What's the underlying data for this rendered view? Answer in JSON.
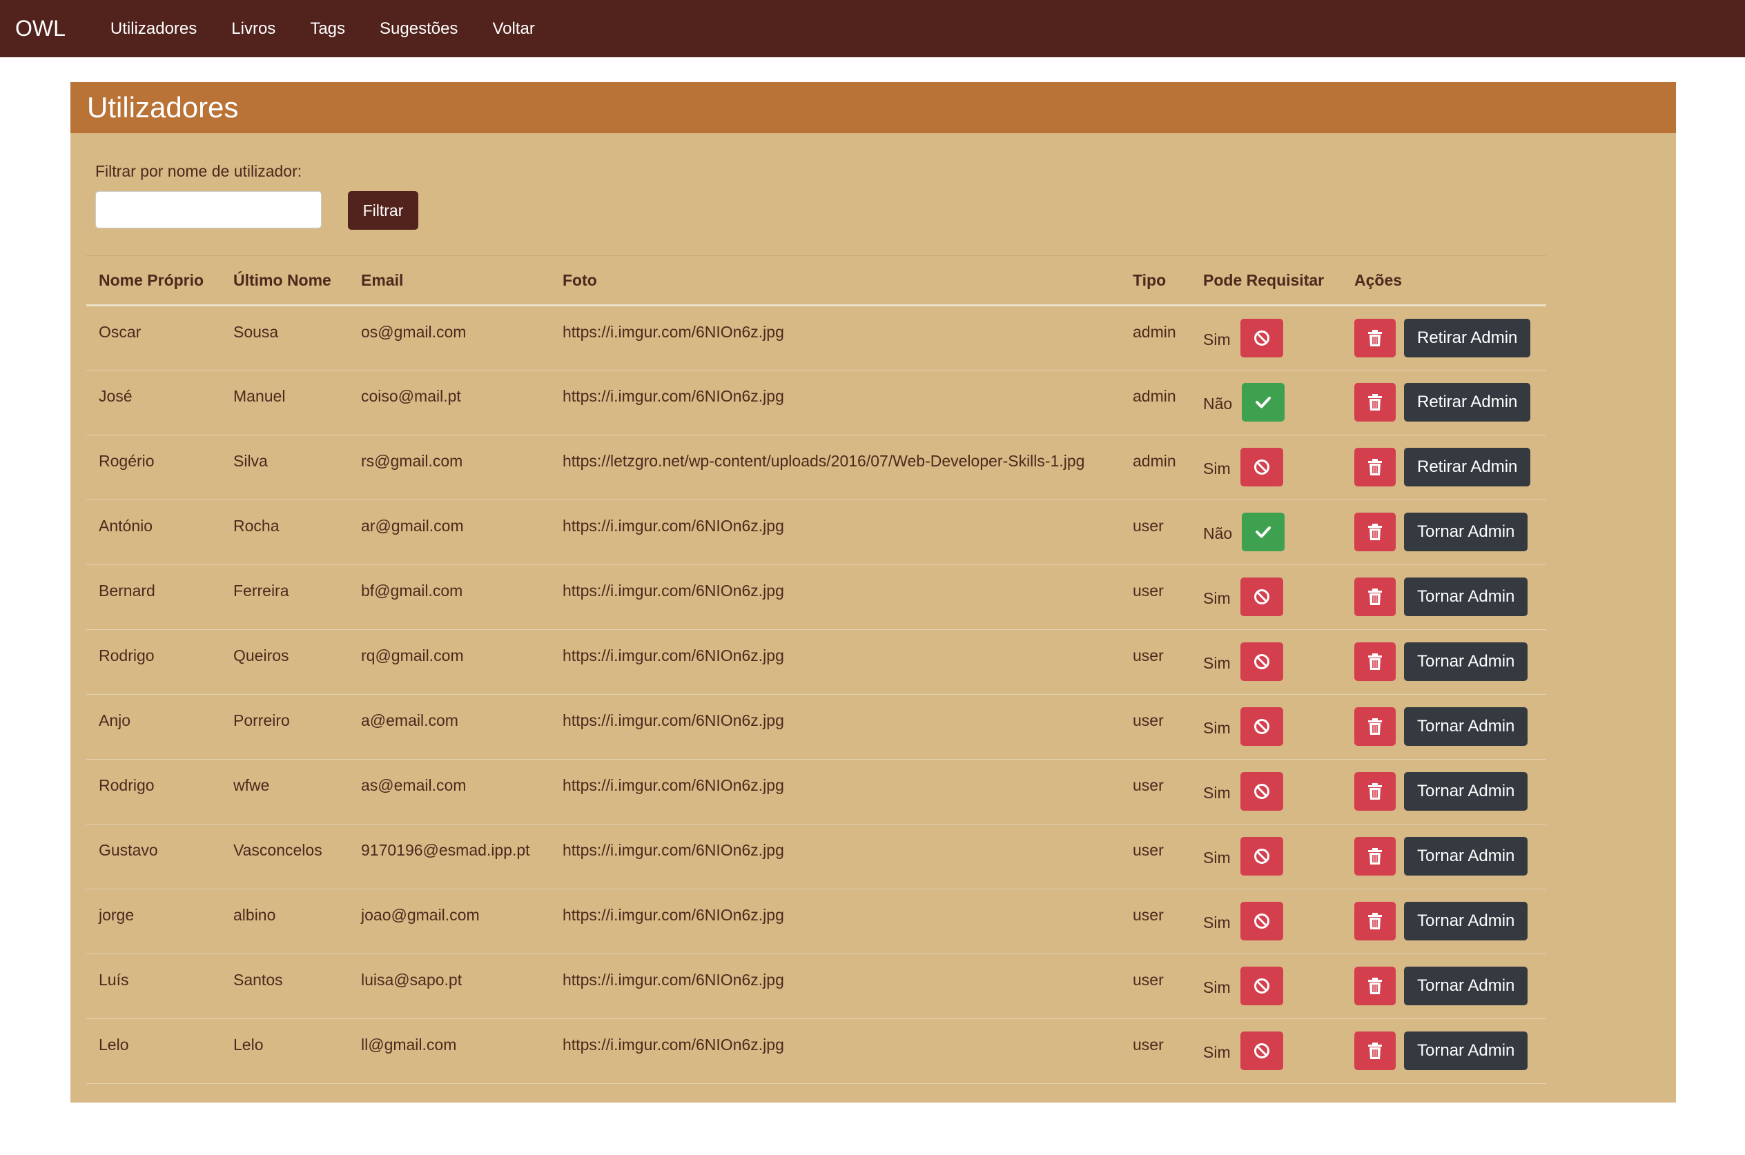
{
  "navbar": {
    "brand": "OWL",
    "links": [
      "Utilizadores",
      "Livros",
      "Tags",
      "Sugestões",
      "Voltar"
    ]
  },
  "page": {
    "title": "Utilizadores",
    "filter_label": "Filtrar por nome de utilizador:",
    "filter_value": "",
    "filter_button": "Filtrar"
  },
  "table": {
    "headers": [
      "Nome Próprio",
      "Último Nome",
      "Email",
      "Foto",
      "Tipo",
      "Pode Requisitar",
      "Ações"
    ],
    "rows": [
      {
        "first": "Oscar",
        "last": "Sousa",
        "email": "os@gmail.com",
        "photo": "https://i.imgur.com/6NIOn6z.jpg",
        "type": "admin",
        "can_request": "Sim",
        "toggle_icon": "ban-icon",
        "admin_action": "Retirar Admin"
      },
      {
        "first": "José",
        "last": "Manuel",
        "email": "coiso@mail.pt",
        "photo": "https://i.imgur.com/6NIOn6z.jpg",
        "type": "admin",
        "can_request": "Não",
        "toggle_icon": "check-icon",
        "admin_action": "Retirar Admin"
      },
      {
        "first": "Rogério",
        "last": "Silva",
        "email": "rs@gmail.com",
        "photo": "https://letzgro.net/wp-content/uploads/2016/07/Web-Developer-Skills-1.jpg",
        "type": "admin",
        "can_request": "Sim",
        "toggle_icon": "ban-icon",
        "admin_action": "Retirar Admin"
      },
      {
        "first": "António",
        "last": "Rocha",
        "email": "ar@gmail.com",
        "photo": "https://i.imgur.com/6NIOn6z.jpg",
        "type": "user",
        "can_request": "Não",
        "toggle_icon": "check-icon",
        "admin_action": "Tornar Admin"
      },
      {
        "first": "Bernard",
        "last": "Ferreira",
        "email": "bf@gmail.com",
        "photo": "https://i.imgur.com/6NIOn6z.jpg",
        "type": "user",
        "can_request": "Sim",
        "toggle_icon": "ban-icon",
        "admin_action": "Tornar Admin"
      },
      {
        "first": "Rodrigo",
        "last": "Queiros",
        "email": "rq@gmail.com",
        "photo": "https://i.imgur.com/6NIOn6z.jpg",
        "type": "user",
        "can_request": "Sim",
        "toggle_icon": "ban-icon",
        "admin_action": "Tornar Admin"
      },
      {
        "first": "Anjo",
        "last": "Porreiro",
        "email": "a@email.com",
        "photo": "https://i.imgur.com/6NIOn6z.jpg",
        "type": "user",
        "can_request": "Sim",
        "toggle_icon": "ban-icon",
        "admin_action": "Tornar Admin"
      },
      {
        "first": "Rodrigo",
        "last": "wfwe",
        "email": "as@email.com",
        "photo": "https://i.imgur.com/6NIOn6z.jpg",
        "type": "user",
        "can_request": "Sim",
        "toggle_icon": "ban-icon",
        "admin_action": "Tornar Admin"
      },
      {
        "first": "Gustavo",
        "last": "Vasconcelos",
        "email": "9170196@esmad.ipp.pt",
        "photo": "https://i.imgur.com/6NIOn6z.jpg",
        "type": "user",
        "can_request": "Sim",
        "toggle_icon": "ban-icon",
        "admin_action": "Tornar Admin"
      },
      {
        "first": "jorge",
        "last": "albino",
        "email": "joao@gmail.com",
        "photo": "https://i.imgur.com/6NIOn6z.jpg",
        "type": "user",
        "can_request": "Sim",
        "toggle_icon": "ban-icon",
        "admin_action": "Tornar Admin"
      },
      {
        "first": "Luís",
        "last": "Santos",
        "email": "luisa@sapo.pt",
        "photo": "https://i.imgur.com/6NIOn6z.jpg",
        "type": "user",
        "can_request": "Sim",
        "toggle_icon": "ban-icon",
        "admin_action": "Tornar Admin"
      },
      {
        "first": "Lelo",
        "last": "Lelo",
        "email": "ll@gmail.com",
        "photo": "https://i.imgur.com/6NIOn6z.jpg",
        "type": "user",
        "can_request": "Sim",
        "toggle_icon": "ban-icon",
        "admin_action": "Tornar Admin"
      }
    ]
  },
  "colors": {
    "navbar": "#52231c",
    "card_header": "#b97337",
    "card_body": "#d7b986",
    "danger": "#d43f4e",
    "success": "#3da14f",
    "dark": "#343a40"
  }
}
